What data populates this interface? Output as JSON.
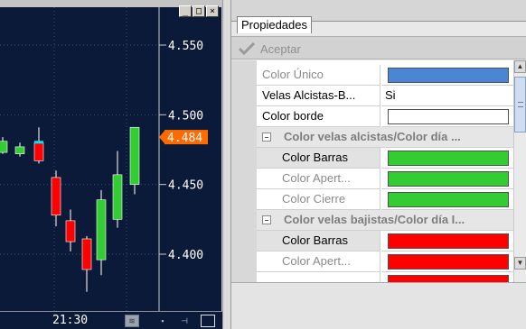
{
  "window": {
    "minimize_glyph": "_",
    "maximize_glyph": "□",
    "close_glyph": "×"
  },
  "chart": {
    "price_labels": [
      "4.550",
      "4.500",
      "4.450",
      "4.400"
    ],
    "current_price": "4.484",
    "time_label": "21:30",
    "colors": {
      "background": "#0c1a3a",
      "bull": "#33cc33",
      "bear": "#ff0000",
      "wick": "#b8b8b8",
      "current_price_bg": "#ff6a00"
    },
    "candles": [
      {
        "open": 4.473,
        "close": 4.481,
        "high": 4.484,
        "low": 4.472,
        "dir": "up"
      },
      {
        "open": 4.472,
        "close": 4.477,
        "high": 4.48,
        "low": 4.47,
        "dir": "up"
      },
      {
        "open": 4.48,
        "close": 4.467,
        "high": 4.491,
        "low": 4.465,
        "dir": "down"
      },
      {
        "open": 4.455,
        "close": 4.428,
        "high": 4.46,
        "low": 4.42,
        "dir": "down"
      },
      {
        "open": 4.424,
        "close": 4.409,
        "high": 4.432,
        "low": 4.402,
        "dir": "down"
      },
      {
        "open": 4.411,
        "close": 4.389,
        "high": 4.413,
        "low": 4.373,
        "dir": "down"
      },
      {
        "open": 4.396,
        "close": 4.439,
        "high": 4.446,
        "low": 4.385,
        "dir": "up"
      },
      {
        "open": 4.425,
        "close": 4.457,
        "high": 4.474,
        "low": 4.419,
        "dir": "up"
      },
      {
        "open": 4.45,
        "close": 4.491,
        "high": 4.491,
        "low": 4.443,
        "dir": "up"
      }
    ]
  },
  "properties_panel": {
    "tab_label": "Propiedades",
    "toolbar": {
      "accept_label": "Aceptar",
      "accept_icon": "checkmark-icon"
    },
    "rows": [
      {
        "kind": "prop",
        "label": "Color Único",
        "dim": true,
        "value_type": "color",
        "color": "#4a86d4"
      },
      {
        "kind": "prop",
        "label": "Velas Alcistas-B...",
        "dim": false,
        "value_type": "text",
        "value": "Si"
      },
      {
        "kind": "prop",
        "label": "Color borde",
        "dim": false,
        "value_type": "color",
        "color": "#ffffff"
      },
      {
        "kind": "category",
        "label": "Color velas alcistas/Color día ..."
      },
      {
        "kind": "prop",
        "label": "Color Barras",
        "dim": false,
        "sub": true,
        "selected": true,
        "value_type": "color",
        "color": "#33cc33"
      },
      {
        "kind": "prop",
        "label": "Color Apert...",
        "dim": true,
        "sub": true,
        "value_type": "color",
        "color": "#33cc33"
      },
      {
        "kind": "prop",
        "label": "Color Cierre",
        "dim": true,
        "sub": true,
        "value_type": "color",
        "color": "#33cc33"
      },
      {
        "kind": "category",
        "label": "Color velas bajistas/Color día I..."
      },
      {
        "kind": "prop",
        "label": "Color Barras",
        "dim": false,
        "sub": true,
        "selected": true,
        "value_type": "color",
        "color": "#ff0000"
      },
      {
        "kind": "prop",
        "label": "Color Apert...",
        "dim": true,
        "sub": true,
        "value_type": "color",
        "color": "#ff0000"
      },
      {
        "kind": "prop",
        "label": "",
        "dim": true,
        "sub": true,
        "value_type": "color",
        "color": "#ff0000"
      }
    ],
    "scrollbar": {
      "up_arrow": "▲",
      "down_arrow": "▼"
    }
  }
}
